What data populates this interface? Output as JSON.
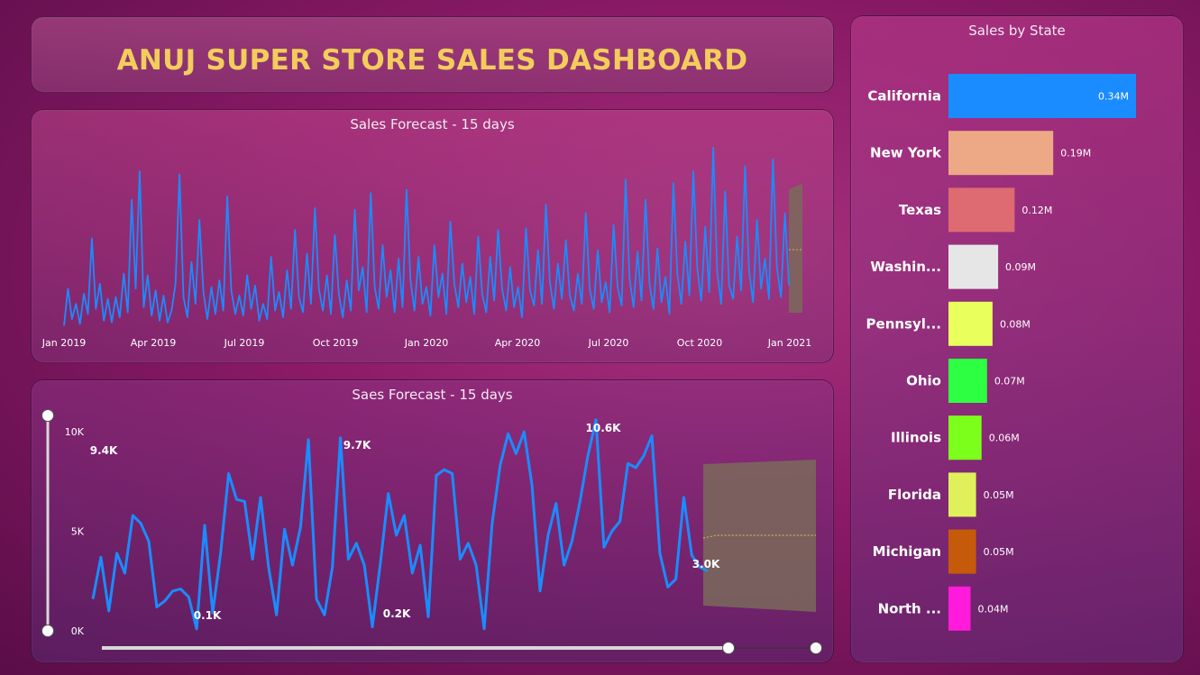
{
  "dashboard": {
    "title": "ANUJ SUPER STORE SALES DASHBOARD"
  },
  "colors": {
    "line": "#1a8cff",
    "forecast_band": "#7a6a5a",
    "title": "#f2cd5c"
  },
  "chart_data": [
    {
      "type": "line",
      "title": "Sales Forecast - 15 days",
      "x_tick_labels": [
        "Jan 2019",
        "Apr 2019",
        "Jul 2019",
        "Oct 2019",
        "Jan 2020",
        "Apr 2020",
        "Jul 2020",
        "Oct 2020",
        "Jan 2021"
      ],
      "x_range": [
        "2019-01-01",
        "2021-01-15"
      ],
      "forecast": true,
      "forecast_days": 15,
      "series": [
        {
          "values": [
            0.3,
            2.5,
            0.7,
            1.6,
            0.4,
            2.2,
            1.0,
            5.5,
            1.3,
            2.8,
            0.6,
            1.9,
            0.5,
            2.0,
            0.8,
            3.4,
            1.1,
            7.8,
            2.5,
            9.5,
            1.4,
            3.3,
            0.9,
            2.4,
            0.6,
            2.1,
            0.5,
            1.2,
            2.8,
            9.3,
            2.0,
            0.8,
            4.1,
            1.6,
            6.6,
            2.3,
            0.7,
            2.6,
            1.0,
            3.0,
            1.2,
            8.0,
            2.4,
            1.0,
            2.1,
            0.9,
            3.3,
            1.3,
            2.7,
            0.6,
            1.6,
            0.7,
            4.4,
            1.2,
            2.3,
            0.8,
            3.6,
            1.3,
            6.0,
            2.0,
            1.1,
            4.6,
            1.6,
            7.3,
            2.5,
            1.2,
            3.3,
            1.0,
            5.7,
            2.2,
            0.8,
            3.0,
            1.2,
            7.2,
            2.4,
            3.8,
            1.1,
            8.2,
            2.6,
            1.3,
            5.1,
            2.0,
            3.6,
            1.1,
            4.3,
            1.4,
            8.4,
            3.0,
            1.2,
            4.4,
            1.6,
            2.6,
            0.9,
            5.1,
            2.0,
            3.4,
            1.0,
            6.5,
            2.8,
            1.4,
            4.0,
            1.7,
            3.2,
            1.0,
            5.6,
            2.2,
            1.1,
            4.4,
            1.8,
            6.0,
            2.5,
            1.2,
            3.8,
            1.4,
            2.6,
            0.8,
            6.1,
            2.4,
            1.5,
            4.8,
            1.6,
            7.5,
            2.9,
            1.3,
            4.0,
            1.9,
            5.4,
            2.1,
            1.2,
            3.4,
            1.6,
            7.0,
            2.5,
            1.3,
            4.8,
            1.7,
            2.9,
            1.1,
            6.3,
            2.6,
            1.5,
            9.0,
            3.1,
            1.4,
            4.7,
            1.8,
            7.8,
            2.8,
            1.3,
            4.9,
            1.7,
            3.2,
            1.0,
            8.8,
            3.4,
            1.6,
            5.3,
            2.1,
            9.5,
            3.7,
            1.8,
            6.2,
            2.3,
            10.9,
            3.5,
            1.6,
            8.3,
            2.7,
            1.9,
            5.6,
            2.4,
            9.8,
            3.6,
            1.7,
            6.6,
            2.5,
            4.3,
            1.9,
            10.2,
            3.8,
            2.0,
            7.0,
            2.7
          ]
        }
      ]
    },
    {
      "type": "line",
      "title": "Saes Forecast - 15 days",
      "y_tick_labels": [
        "10K",
        "5K",
        "0K"
      ],
      "ylim": [
        0,
        11000
      ],
      "forecast": true,
      "forecast_days": 15,
      "data_labels": [
        "9.4K",
        "9.7K",
        "10.6K",
        "0.1K",
        "0.2K",
        "3.0K"
      ],
      "series": [
        {
          "values": [
            1600,
            3700,
            1000,
            3900,
            2900,
            5800,
            5400,
            4500,
            1200,
            1500,
            2000,
            2100,
            1700,
            100,
            5300,
            900,
            3900,
            7900,
            6600,
            6500,
            3600,
            6700,
            3200,
            800,
            5100,
            3300,
            5200,
            9600,
            1600,
            800,
            3200,
            9700,
            3600,
            4400,
            3300,
            200,
            3400,
            6900,
            4800,
            5800,
            2900,
            4300,
            700,
            7800,
            8100,
            7900,
            3600,
            4400,
            3300,
            100,
            5400,
            8300,
            9900,
            8900,
            10000,
            7300,
            2000,
            4800,
            6400,
            3300,
            4500,
            6500,
            8800,
            10600,
            4200,
            5000,
            5500,
            8400,
            8200,
            8800,
            9800,
            3900,
            2200,
            2600,
            6700,
            3800,
            3200,
            3000
          ]
        }
      ]
    },
    {
      "type": "bar",
      "title": "Sales by State",
      "categories": [
        "California",
        "New York",
        "Texas",
        "Washin...",
        "Pennsyl...",
        "Ohio",
        "Illinois",
        "Florida",
        "Michigan",
        "North ..."
      ],
      "values": [
        0.34,
        0.19,
        0.12,
        0.09,
        0.08,
        0.07,
        0.06,
        0.05,
        0.05,
        0.04
      ],
      "value_labels": [
        "0.34M",
        "0.19M",
        "0.12M",
        "0.09M",
        "0.08M",
        "0.07M",
        "0.06M",
        "0.05M",
        "0.05M",
        "0.04M"
      ],
      "bar_colors": [
        "#1a8cff",
        "#eda886",
        "#de6a72",
        "#e6e6e6",
        "#e8ff5c",
        "#2dff42",
        "#7cff1a",
        "#e0f05a",
        "#c55a0a",
        "#ff1adc"
      ]
    }
  ]
}
